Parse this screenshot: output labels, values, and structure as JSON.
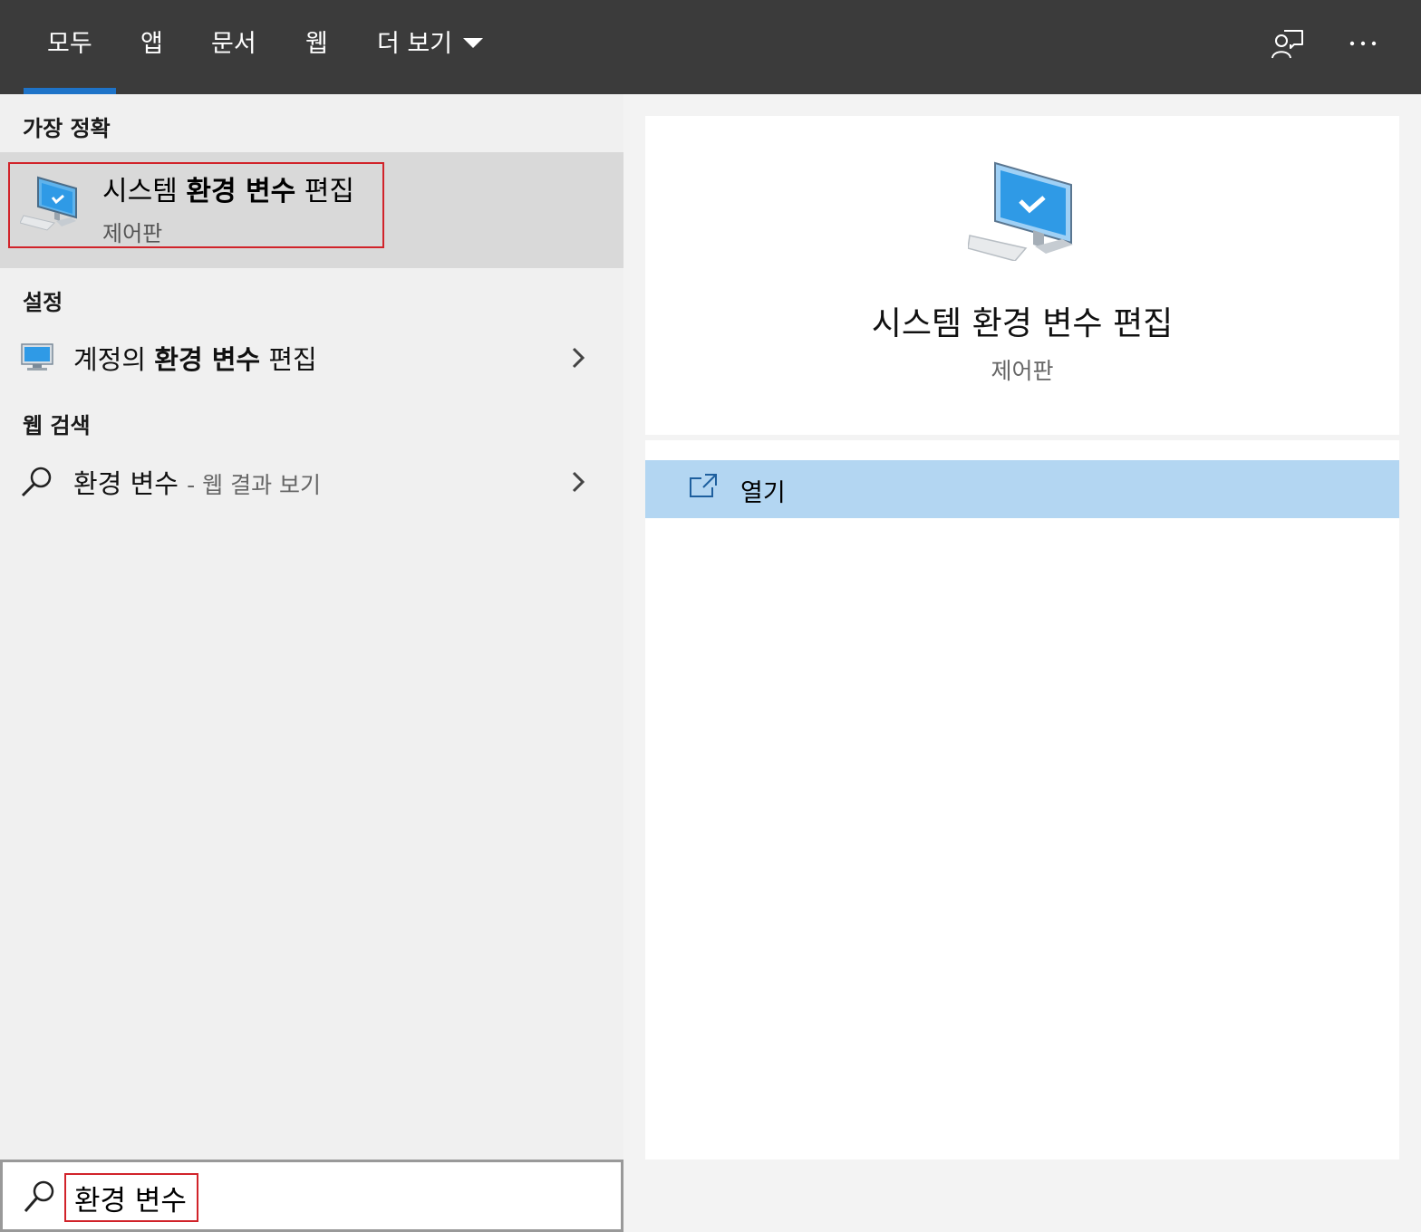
{
  "topbar": {
    "tabs": [
      {
        "label": "모두",
        "active": true
      },
      {
        "label": "앱"
      },
      {
        "label": "문서"
      },
      {
        "label": "웹"
      },
      {
        "label": "더 보기"
      }
    ],
    "icons": [
      "feedback-icon",
      "more-options-icon"
    ]
  },
  "best_match": {
    "section_title": "가장 정확",
    "title_prefix": "시스템",
    "title_bold": "환경 변수",
    "title_suffix": "편집",
    "subtitle": "제어판",
    "icon": "monitor-checkmark-icon"
  },
  "settings": {
    "section_title": "설정",
    "item_prefix": "계정의",
    "item_bold": "환경 변수",
    "item_suffix": "편집",
    "icon": "monitor-icon"
  },
  "web_search": {
    "section_title": "웹 검색",
    "query": "환경 변수",
    "suffix": "- 웹 결과 보기",
    "icon": "search-icon"
  },
  "preview": {
    "title": "시스템 환경 변수 편집",
    "subtitle": "제어판",
    "open_label": "열기",
    "icon": "monitor-checkmark-icon"
  },
  "search": {
    "value": "환경 변수"
  },
  "colors": {
    "topbar": "#3b3b3b",
    "accent": "#1e73c8",
    "highlight_outline": "#d1232a",
    "selected_row": "#d9d9d9",
    "open_row": "#b3d6f2"
  }
}
